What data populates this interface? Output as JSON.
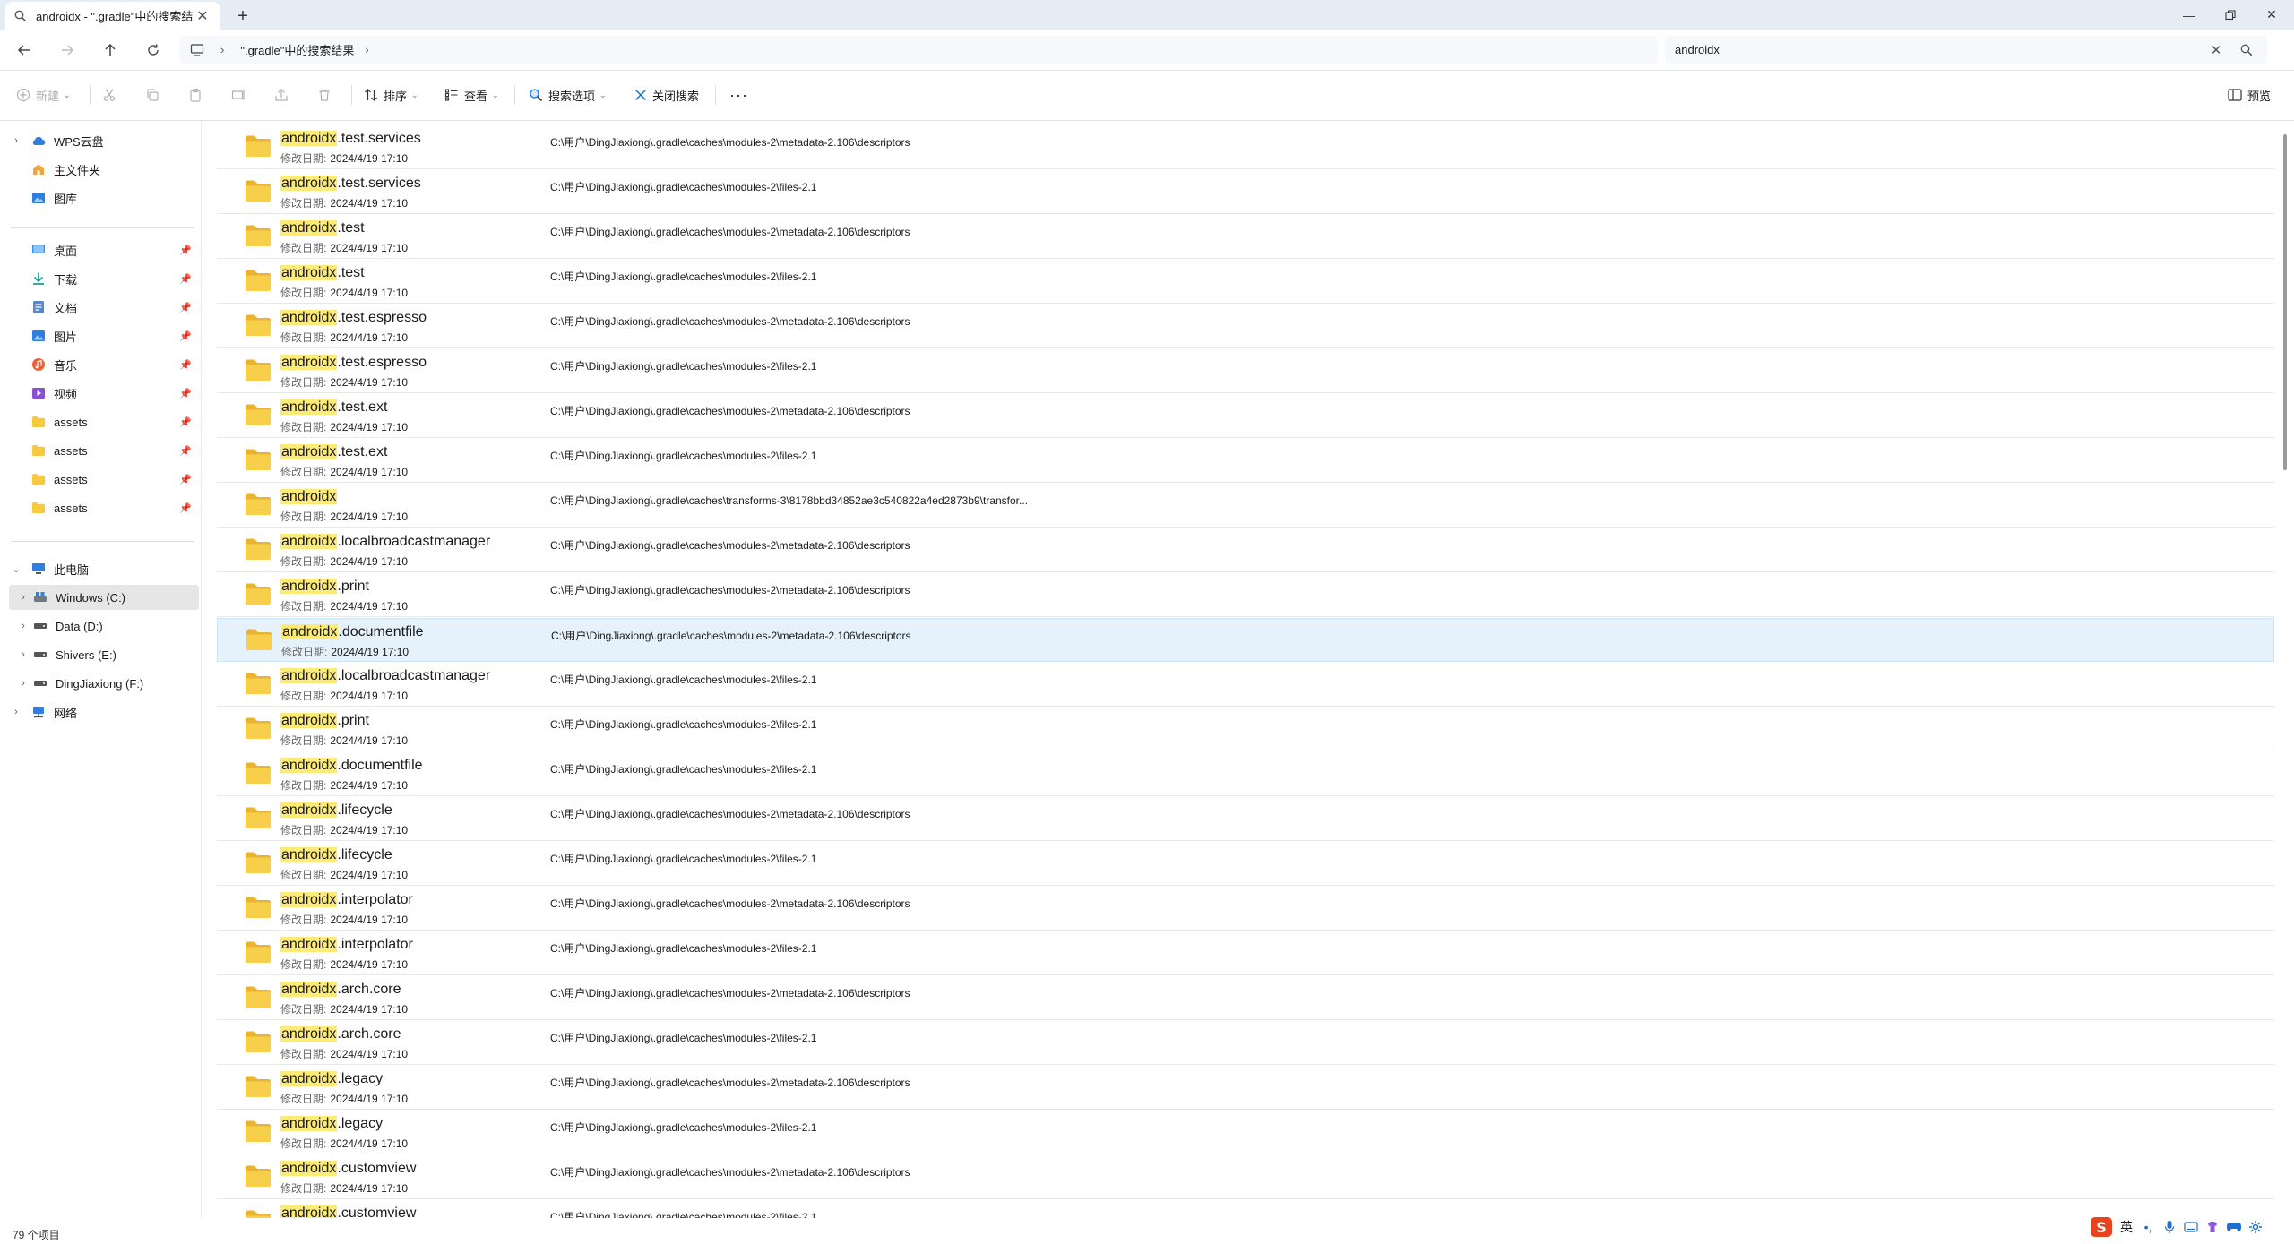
{
  "tab": {
    "title": "androidx - \".gradle\"中的搜索结果"
  },
  "address": {
    "location": "\".gradle\"中的搜索结果"
  },
  "search": {
    "value": "androidx"
  },
  "toolbar": {
    "new_label": "新建",
    "sort_label": "排序",
    "view_label": "查看",
    "search_options_label": "搜索选项",
    "close_search_label": "关闭搜索",
    "preview_label": "预览"
  },
  "nav": {
    "wps": "WPS云盘",
    "home": "主文件夹",
    "gallery": "图库",
    "quick": [
      {
        "label": "桌面",
        "icon": "desktop-icon"
      },
      {
        "label": "下载",
        "icon": "download-icon"
      },
      {
        "label": "文档",
        "icon": "document-icon"
      },
      {
        "label": "图片",
        "icon": "picture-icon"
      },
      {
        "label": "音乐",
        "icon": "music-icon"
      },
      {
        "label": "视频",
        "icon": "video-icon"
      },
      {
        "label": "assets",
        "icon": "folder-icon"
      },
      {
        "label": "assets",
        "icon": "folder-icon"
      },
      {
        "label": "assets",
        "icon": "folder-icon"
      },
      {
        "label": "assets",
        "icon": "folder-icon"
      }
    ],
    "this_pc": "此电脑",
    "drives": [
      "Windows (C:)",
      "Data (D:)",
      "Shivers (E:)",
      "DingJiaxiong (F:)"
    ],
    "network": "网络"
  },
  "results": {
    "highlight": "androidx",
    "meta_label": "修改日期:",
    "items": [
      {
        "suffix": ".test.services",
        "date": "2024/4/19 17:10",
        "path": "C:\\用户\\DingJiaxiong\\.gradle\\caches\\modules-2\\metadata-2.106\\descriptors"
      },
      {
        "suffix": ".test.services",
        "date": "2024/4/19 17:10",
        "path": "C:\\用户\\DingJiaxiong\\.gradle\\caches\\modules-2\\files-2.1"
      },
      {
        "suffix": ".test",
        "date": "2024/4/19 17:10",
        "path": "C:\\用户\\DingJiaxiong\\.gradle\\caches\\modules-2\\metadata-2.106\\descriptors"
      },
      {
        "suffix": ".test",
        "date": "2024/4/19 17:10",
        "path": "C:\\用户\\DingJiaxiong\\.gradle\\caches\\modules-2\\files-2.1"
      },
      {
        "suffix": ".test.espresso",
        "date": "2024/4/19 17:10",
        "path": "C:\\用户\\DingJiaxiong\\.gradle\\caches\\modules-2\\metadata-2.106\\descriptors"
      },
      {
        "suffix": ".test.espresso",
        "date": "2024/4/19 17:10",
        "path": "C:\\用户\\DingJiaxiong\\.gradle\\caches\\modules-2\\files-2.1"
      },
      {
        "suffix": ".test.ext",
        "date": "2024/4/19 17:10",
        "path": "C:\\用户\\DingJiaxiong\\.gradle\\caches\\modules-2\\metadata-2.106\\descriptors"
      },
      {
        "suffix": ".test.ext",
        "date": "2024/4/19 17:10",
        "path": "C:\\用户\\DingJiaxiong\\.gradle\\caches\\modules-2\\files-2.1"
      },
      {
        "suffix": "",
        "date": "2024/4/19 17:10",
        "path": "C:\\用户\\DingJiaxiong\\.gradle\\caches\\transforms-3\\8178bbd34852ae3c540822a4ed2873b9\\transfor..."
      },
      {
        "suffix": ".localbroadcastmanager",
        "date": "2024/4/19 17:10",
        "path": "C:\\用户\\DingJiaxiong\\.gradle\\caches\\modules-2\\metadata-2.106\\descriptors"
      },
      {
        "suffix": ".print",
        "date": "2024/4/19 17:10",
        "path": "C:\\用户\\DingJiaxiong\\.gradle\\caches\\modules-2\\metadata-2.106\\descriptors"
      },
      {
        "suffix": ".documentfile",
        "date": "2024/4/19 17:10",
        "path": "C:\\用户\\DingJiaxiong\\.gradle\\caches\\modules-2\\metadata-2.106\\descriptors",
        "hover": true
      },
      {
        "suffix": ".localbroadcastmanager",
        "date": "2024/4/19 17:10",
        "path": "C:\\用户\\DingJiaxiong\\.gradle\\caches\\modules-2\\files-2.1"
      },
      {
        "suffix": ".print",
        "date": "2024/4/19 17:10",
        "path": "C:\\用户\\DingJiaxiong\\.gradle\\caches\\modules-2\\files-2.1"
      },
      {
        "suffix": ".documentfile",
        "date": "2024/4/19 17:10",
        "path": "C:\\用户\\DingJiaxiong\\.gradle\\caches\\modules-2\\files-2.1"
      },
      {
        "suffix": ".lifecycle",
        "date": "2024/4/19 17:10",
        "path": "C:\\用户\\DingJiaxiong\\.gradle\\caches\\modules-2\\metadata-2.106\\descriptors"
      },
      {
        "suffix": ".lifecycle",
        "date": "2024/4/19 17:10",
        "path": "C:\\用户\\DingJiaxiong\\.gradle\\caches\\modules-2\\files-2.1"
      },
      {
        "suffix": ".interpolator",
        "date": "2024/4/19 17:10",
        "path": "C:\\用户\\DingJiaxiong\\.gradle\\caches\\modules-2\\metadata-2.106\\descriptors"
      },
      {
        "suffix": ".interpolator",
        "date": "2024/4/19 17:10",
        "path": "C:\\用户\\DingJiaxiong\\.gradle\\caches\\modules-2\\files-2.1"
      },
      {
        "suffix": ".arch.core",
        "date": "2024/4/19 17:10",
        "path": "C:\\用户\\DingJiaxiong\\.gradle\\caches\\modules-2\\metadata-2.106\\descriptors"
      },
      {
        "suffix": ".arch.core",
        "date": "2024/4/19 17:10",
        "path": "C:\\用户\\DingJiaxiong\\.gradle\\caches\\modules-2\\files-2.1"
      },
      {
        "suffix": ".legacy",
        "date": "2024/4/19 17:10",
        "path": "C:\\用户\\DingJiaxiong\\.gradle\\caches\\modules-2\\metadata-2.106\\descriptors"
      },
      {
        "suffix": ".legacy",
        "date": "2024/4/19 17:10",
        "path": "C:\\用户\\DingJiaxiong\\.gradle\\caches\\modules-2\\files-2.1"
      },
      {
        "suffix": ".customview",
        "date": "2024/4/19 17:10",
        "path": "C:\\用户\\DingJiaxiong\\.gradle\\caches\\modules-2\\metadata-2.106\\descriptors"
      },
      {
        "suffix": ".customview",
        "date": "",
        "path": "C:\\用户\\DingJiaxiong\\.gradle\\caches\\modules-2\\files-2.1"
      }
    ]
  },
  "status": {
    "count": "79 个项目"
  },
  "ime": {
    "lang": "英"
  },
  "colors": {
    "highlight": "#fdeb78",
    "folder": "#f8c93e",
    "hover_row": "#e5f1fb",
    "accent": "#1f6fd1"
  }
}
